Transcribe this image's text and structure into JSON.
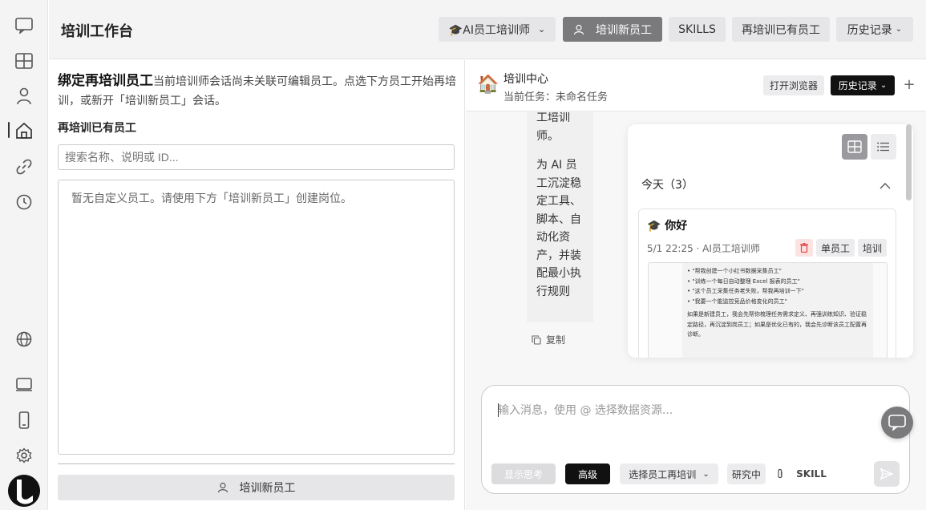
{
  "sidebar": {
    "items": [
      {
        "icon": "chat-bubble-icon"
      },
      {
        "icon": "grid-icon"
      },
      {
        "icon": "user-icon"
      },
      {
        "icon": "home-icon",
        "active": true
      },
      {
        "icon": "link-icon"
      },
      {
        "icon": "clock-icon"
      },
      {
        "icon": "globe-icon"
      },
      {
        "icon": "tablet-icon"
      },
      {
        "icon": "mobile-icon"
      },
      {
        "icon": "gear-icon"
      }
    ]
  },
  "header": {
    "title": "培训工作台",
    "trainer_select": "🎓AI员工培训师",
    "new_employee": "培训新员工",
    "skills": "SKILLS",
    "retrain": "再培训已有员工",
    "history": "历史记录"
  },
  "left": {
    "bind_title": "绑定再培训员工",
    "bind_desc": "当前培训师会话尚未关联可编辑员工。点选下方员工开始再培训，或新开「培训新员工」会话。",
    "section_label": "再培训已有员工",
    "search_placeholder": "搜索名称、说明或 ID...",
    "empty_text": "暂无自定义员工。请使用下方「培训新员工」创建岗位。",
    "new_button": "培训新员工"
  },
  "right": {
    "house_emoji": "🏠",
    "title": "培训中心",
    "task": "当前任务：未命名任务",
    "open_browser": "打开浏览器",
    "history": "历史记录",
    "bubble_top": "工培训师。",
    "bubble_main": "为 AI 员工沉淀稳定工具、脚本、自动化资产，并装配最小执行规则",
    "copy": "复制",
    "history_panel": {
      "section": "今天（3）",
      "card": {
        "title": "🎓 你好",
        "meta": "5/1 22:25 · AI员工培训师",
        "tags": [
          "单员工",
          "培训"
        ],
        "preview": [
          "• \"帮我创建一个小红书数据采集员工\"",
          "• \"训练一个每日自动整理 Excel 报表的员工\"",
          "• \"这个员工采集任务老失败，帮我再培训一下\"",
          "• \"我要一个能监控竞品价格变化的员工\"",
          "如果是新建员工，我会先帮你梳理任务需求定义、再强训练知识、验证稳定路径，再沉淀到岗员工；如果是优化已有的，我会先诊断该员工配置再诊断。"
        ]
      }
    },
    "input": {
      "placeholder": "输入消息，使用 @ 选择数据资源...",
      "show_thinking": "显示思考",
      "advanced": "高级",
      "select_employee": "选择员工再培训",
      "research": "研究中",
      "skill": "SKILL"
    }
  },
  "colors": {
    "active": "#111111",
    "muted_button": "#e6e6e8",
    "dark_button": "#7a7a7d",
    "delete_bg": "#fde2e2",
    "delete_icon": "#e04040"
  }
}
